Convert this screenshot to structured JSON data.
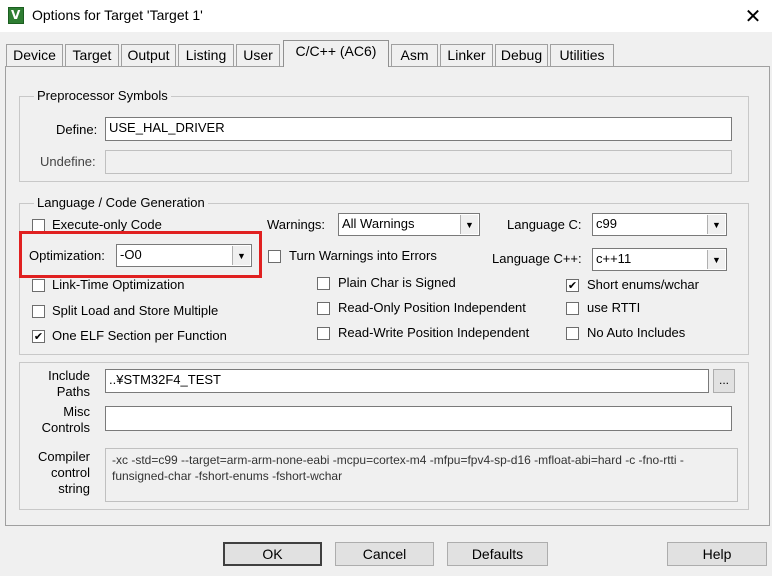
{
  "window": {
    "title": "Options for Target 'Target 1'",
    "close_glyph": "✕",
    "icon_letter": "V"
  },
  "tabs": [
    "Device",
    "Target",
    "Output",
    "Listing",
    "User",
    "C/C++ (AC6)",
    "Asm",
    "Linker",
    "Debug",
    "Utilities"
  ],
  "active_tab": "C/C++ (AC6)",
  "preprocessor": {
    "title": "Preprocessor Symbols",
    "define_label": "Define:",
    "define_value": "USE_HAL_DRIVER",
    "undefine_label": "Undefine:",
    "undefine_value": ""
  },
  "language": {
    "title": "Language / Code Generation",
    "execute_only": {
      "label": "Execute-only Code",
      "checked": false
    },
    "optimization_label": "Optimization:",
    "optimization_value": "-O0",
    "lto": {
      "label": "Link-Time Optimization",
      "checked": false
    },
    "split_ls": {
      "label": "Split Load and Store Multiple",
      "checked": false
    },
    "one_elf": {
      "label": "One ELF Section per Function",
      "checked": true
    },
    "warnings_label": "Warnings:",
    "warnings_value": "All Warnings",
    "turn_warnings": {
      "label": "Turn Warnings into Errors",
      "checked": false
    },
    "plain_char": {
      "label": "Plain Char is Signed",
      "checked": false
    },
    "ropi": {
      "label": "Read-Only Position Independent",
      "checked": false
    },
    "rwpi": {
      "label": "Read-Write Position Independent",
      "checked": false
    },
    "lang_c_label": "Language C:",
    "lang_c_value": "c99",
    "lang_cpp_label": "Language C++:",
    "lang_cpp_value": "c++11",
    "short_enums": {
      "label": "Short enums/wchar",
      "checked": true
    },
    "rtti": {
      "label": "use RTTI",
      "checked": false
    },
    "no_auto": {
      "label": "No Auto Includes",
      "checked": false
    }
  },
  "paths": {
    "include_label_1": "Include",
    "include_label_2": "Paths",
    "include_value": "..¥STM32F4_TEST",
    "browse_label": "...",
    "misc_label_1": "Misc",
    "misc_label_2": "Controls",
    "misc_value": "",
    "compiler_label_1": "Compiler",
    "compiler_label_2": "control",
    "compiler_label_3": "string",
    "compiler_value": "-xc -std=c99 --target=arm-arm-none-eabi -mcpu=cortex-m4 -mfpu=fpv4-sp-d16 -mfloat-abi=hard -c -fno-rtti -funsigned-char -fshort-enums -fshort-wchar"
  },
  "buttons": {
    "ok": "OK",
    "cancel": "Cancel",
    "defaults": "Defaults",
    "help": "Help"
  },
  "colors": {
    "highlight": "#e02020"
  }
}
